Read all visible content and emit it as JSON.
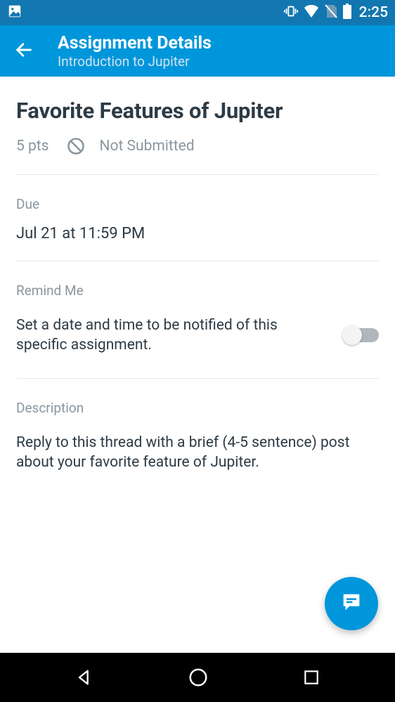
{
  "statusBar": {
    "time": "2:25"
  },
  "appBar": {
    "title": "Assignment Details",
    "subtitle": "Introduction to Jupiter"
  },
  "assignment": {
    "title": "Favorite Features of Jupiter",
    "points": "5 pts",
    "status": "Not Submitted"
  },
  "due": {
    "label": "Due",
    "value": "Jul 21 at 11:59 PM"
  },
  "remind": {
    "label": "Remind Me",
    "text": "Set a date and time to be notified of this specific assignment."
  },
  "description": {
    "label": "Description",
    "text": "Reply to this thread with a brief (4-5 sentence) post about your favorite feature of Jupiter."
  }
}
